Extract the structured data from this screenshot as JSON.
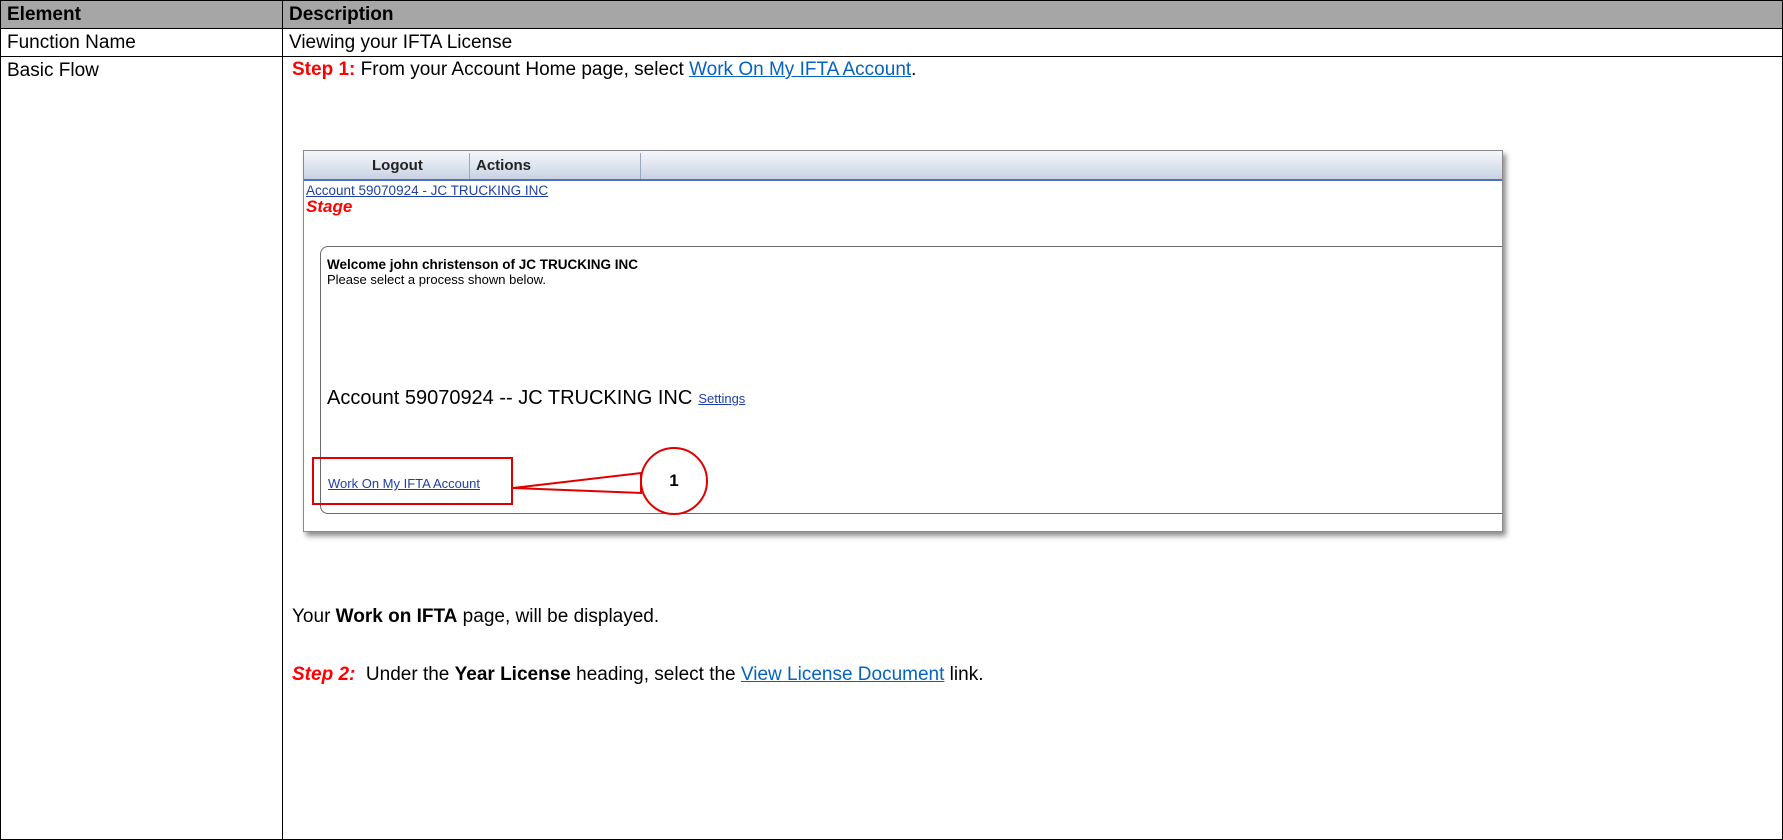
{
  "table": {
    "header_col1": "Element",
    "header_col2": "Description",
    "row1_label": "Function Name",
    "row1_value": "Viewing your IFTA License",
    "row2_label": "Basic Flow"
  },
  "step1": {
    "label": "Step 1:",
    "text_before": " From your Account Home page, select ",
    "link": "Work On My IFTA Account",
    "text_after": "."
  },
  "screenshot": {
    "nav_logout": "Logout",
    "nav_actions": "Actions",
    "account_link": "Account 59070924 - JC TRUCKING INC",
    "stage": "Stage",
    "welcome": "Welcome john christenson of JC TRUCKING INC",
    "please_select": "Please select a process shown below.",
    "account_heading": "Account 59070924 -- JC TRUCKING INC",
    "settings_link": "Settings",
    "ifta_link": "Work On My IFTA Account",
    "callout_number": "1"
  },
  "work_on_ifta": {
    "text_before": "Your ",
    "bold": "Work on IFTA",
    "text_after": " page, will be displayed."
  },
  "step2": {
    "label": "Step 2:",
    "text_before": "  Under the ",
    "bold": "Year License",
    "text_middle": " heading, select the ",
    "link": "View License Document",
    "text_after": " link."
  },
  "colors": {
    "header_bg": "#a6a6a6",
    "step_red": "#ff0000",
    "link_blue": "#0563c1",
    "app_link_blue": "#1f3fa8",
    "callout_red": "#e00000"
  }
}
